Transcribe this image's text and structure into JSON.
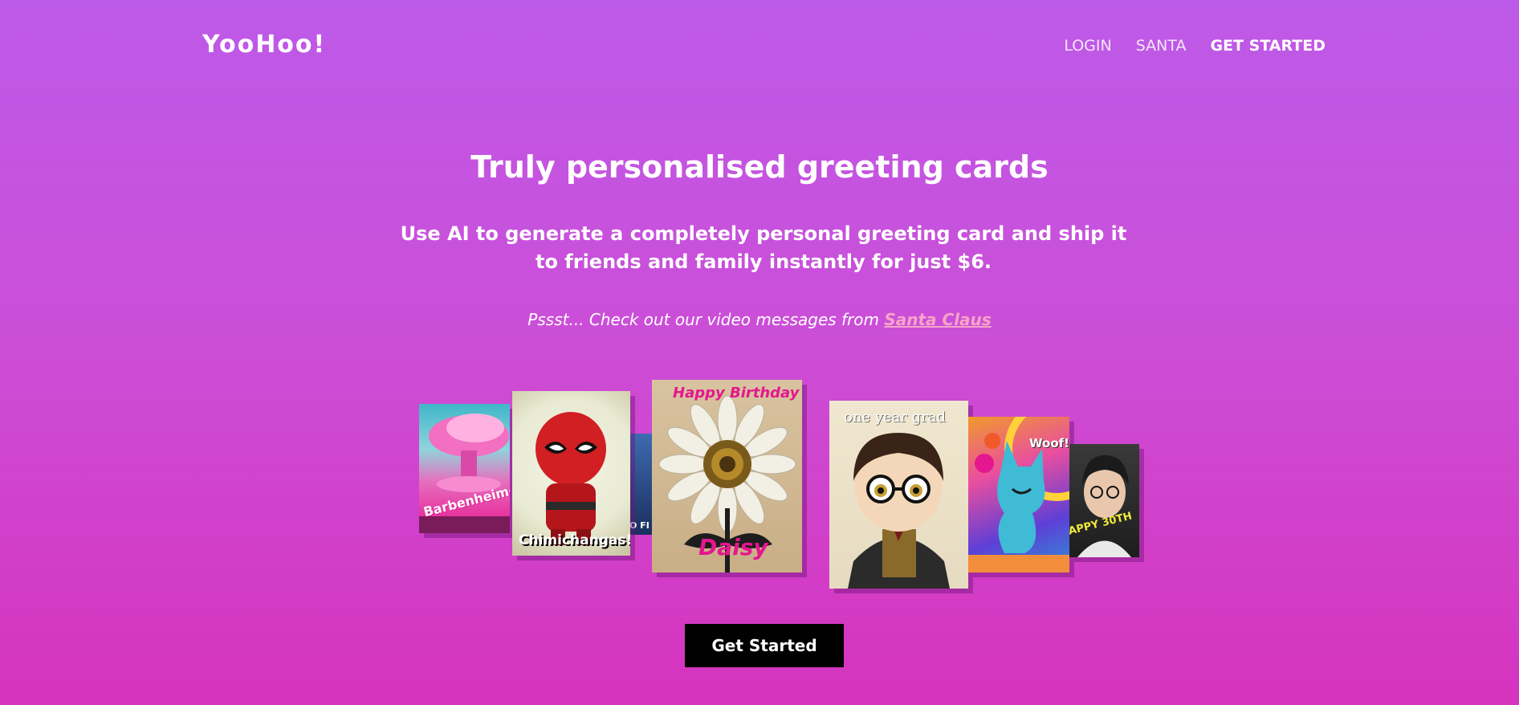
{
  "brand": {
    "logo": "YooHoo!"
  },
  "nav": {
    "login": "LOGIN",
    "santa": "SANTA",
    "get_started": "GET STARTED"
  },
  "hero": {
    "title": "Truly personalised greeting cards",
    "subtitle": "Use AI to generate a completely personal greeting card and ship it to friends and family instantly for just $6.",
    "psst_prefix": "Pssst... Check out our video messages from ",
    "psst_link": "Santa Claus"
  },
  "cards": {
    "barbenheimer": "Barbenheimer",
    "deadpool": "Chimichangas!",
    "partial": "O FI",
    "daisy_top": "Happy Birthday",
    "daisy_bottom": "Daisy",
    "grad": "one year grad",
    "dog": "Woof!",
    "birthday": "APPY 30TH"
  },
  "cta": {
    "label": "Get Started"
  },
  "colors": {
    "accent_pink": "#e5168f",
    "link_pink": "#f7a4c9",
    "button_black": "#000000"
  }
}
